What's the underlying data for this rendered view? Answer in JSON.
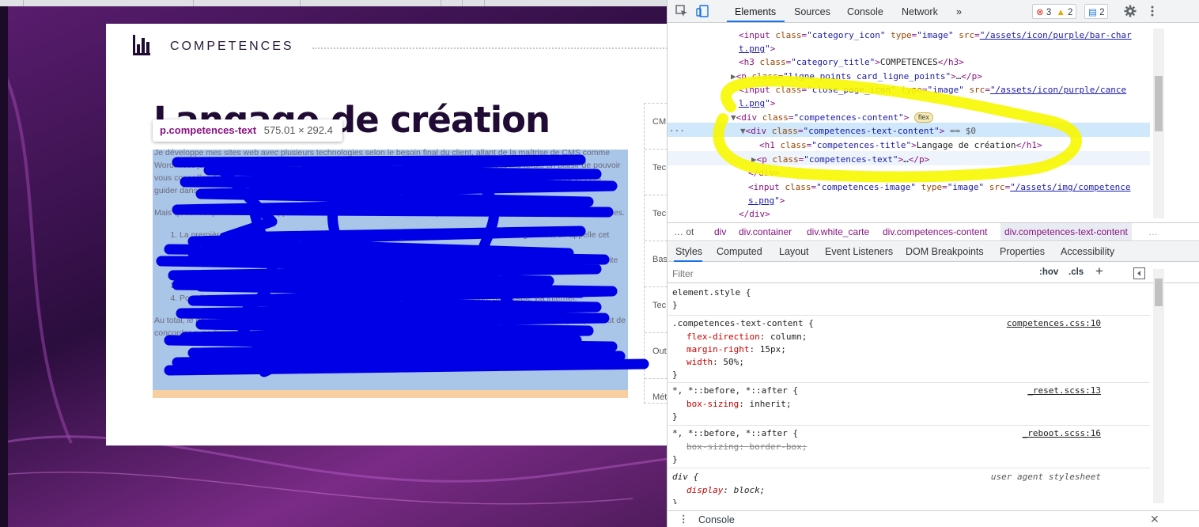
{
  "card": {
    "category_title": "COMPETENCES",
    "title": "Langage de création",
    "paragraph1": "Je développe mes sites web avec plusieurs technologies selon le besoin final du client, allant de la maîtrise de CMS comme WordPress jusqu'à la programmation de A à Z. Dans cette page je vais vous présenter ce que je me ferais un plaisir de pouvoir vous conseiller dans le choix de la technologie la plus adaptée à votre projet de la réalité dans le domaine du web et vous guider dans ce qui répond au mieux à vos attentes pour la création de votre site web.",
    "paragraph2": "Mais qu'est ce que c'est le développement web ? Tout d'abord, il faut savoir qu'un site web peut se diviser en plusieurs couches.",
    "list": [
      "La première, c'est la base de votre site web, vous avez vos données et ici qu'elles sont sauvegardées, on appelle cet endroit la base de données.",
      "La seconde couche se nomme le back-end, c'est la couche de gestion de l'information, c'est ici que l'intelligence du site se trouve.",
      "La troisième couche se nomme le front-end, c'est ici que votre site prend forme sur le plan visuel.",
      "Pour finir nous avons la solution qui permet de sauvegarder votre site et de le rendre accessible via internet."
    ],
    "paragraph3": "Au total, le développeur fait souvent appel à plusieurs technologies dans chacun de ces domaines. Ce bref aperçu a pour but de concorder avec l'image qui indique les technologies que je maîtrise dans ces différents domaines.",
    "side_items": [
      "CM",
      "Tec",
      "Tec",
      "Bas",
      "Tec",
      "Out",
      "Mét"
    ]
  },
  "tooltip": {
    "selector": "p.competences-text",
    "size": "575.01 × 292.4"
  },
  "devtools": {
    "tabs": [
      "Elements",
      "Sources",
      "Console",
      "Network",
      "»"
    ],
    "errors": "3",
    "warnings": "2",
    "messages": "2",
    "elements_lines": [
      {
        "indent": 0,
        "text": "<input class=\"category_icon\" type=\"image\" src=\"/assets/icon/purple/bar-chart.png\">"
      },
      {
        "indent": 0,
        "text": "<h3 class=\"category_title\">COMPETENCES</h3>"
      },
      {
        "indent": 0,
        "text": "<p class=\"ligne_points card_ligne_points\">…</p>"
      },
      {
        "indent": 0,
        "text": "<input class=\"close_page_icon\" type=\"image\" src=\"/assets/icon/purple/cancel.png\">"
      },
      {
        "indent": 0,
        "text": "<div class=\"competences-content\">"
      },
      {
        "indent": 1,
        "text": "<div class=\"competences-text-content\"> == $0"
      },
      {
        "indent": 2,
        "text": "<h1 class=\"competences-title\">Langage de création</h1>"
      },
      {
        "indent": 2,
        "text": "<p class=\"competences-text\">…</p>"
      },
      {
        "indent": 1,
        "text": "</div>"
      },
      {
        "indent": 1,
        "text": "<input class=\"competences-image\" type=\"image\" src=\"/assets/img/competences.png\">"
      },
      {
        "indent": 0,
        "text": "</div>"
      }
    ],
    "flex_badge": "flex",
    "breadcrumbs": [
      "… ot",
      "div",
      "div.container",
      "div.white_carte",
      "div.competences-content",
      "div.competences-text-content",
      "…"
    ],
    "sub_tabs": [
      "Styles",
      "Computed",
      "Layout",
      "Event Listeners",
      "DOM Breakpoints",
      "Properties",
      "Accessibility"
    ],
    "filter_placeholder": "Filter",
    "filter_tools": [
      ":hov",
      ".cls",
      "+"
    ],
    "rules": [
      {
        "selector": "element.style {",
        "source": "",
        "props": []
      },
      {
        "selector": ".competences-text-content {",
        "source": "competences.css:10",
        "props": [
          [
            "flex-direction",
            "column;"
          ],
          [
            "margin-right",
            "15px;"
          ],
          [
            "width",
            "50%;"
          ]
        ]
      },
      {
        "selector": "*, *::before, *::after {",
        "source": "_reset.scss:13",
        "props": [
          [
            "box-sizing",
            "inherit;"
          ]
        ]
      },
      {
        "selector": "*, *::before, *::after {",
        "source": "_reboot.scss:16",
        "props": [
          [
            "box-sizing",
            "border-box;"
          ]
        ]
      },
      {
        "selector": "div {",
        "source": "user agent stylesheet",
        "props": [
          [
            "display",
            "block;"
          ]
        ]
      }
    ],
    "console_label": "Console"
  },
  "colors": {
    "card_title": "#1f0b33",
    "highlight_blue": "#a9c5e8",
    "highlight_orange": "#f8cfa0",
    "scribble": "#0000e6",
    "yellow_marker": "#f7f700",
    "devtools_accent": "#1a73e8"
  }
}
